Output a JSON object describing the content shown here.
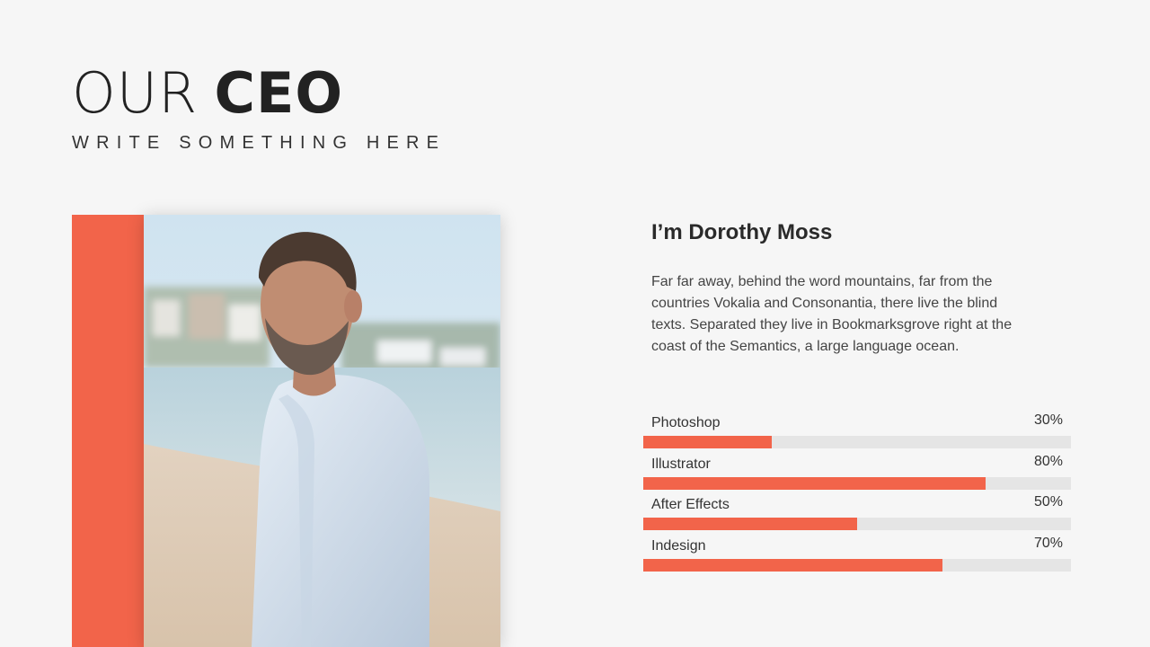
{
  "header": {
    "title_light": "OUR",
    "title_bold": "CEO",
    "subtitle": "WRITE SOMETHING HERE"
  },
  "profile": {
    "name": "I’m Dorothy Moss",
    "bio": "Far far away, behind the word mountains, far from the countries Vokalia and Consonantia, there live the blind texts. Separated they live in Bookmarksgrove right at the coast of the Semantics, a large language ocean."
  },
  "skills": [
    {
      "label": "Photoshop",
      "percent_text": "30%",
      "value": 0.3
    },
    {
      "label": "Illustrator",
      "percent_text": "80%",
      "value": 0.8
    },
    {
      "label": "After Effects",
      "percent_text": "50%",
      "value": 0.5
    },
    {
      "label": "Indesign",
      "percent_text": "70%",
      "value": 0.7
    }
  ],
  "colors": {
    "accent": "#f2644a",
    "track": "#e5e5e5",
    "background": "#f6f6f6",
    "text": "#222222"
  }
}
